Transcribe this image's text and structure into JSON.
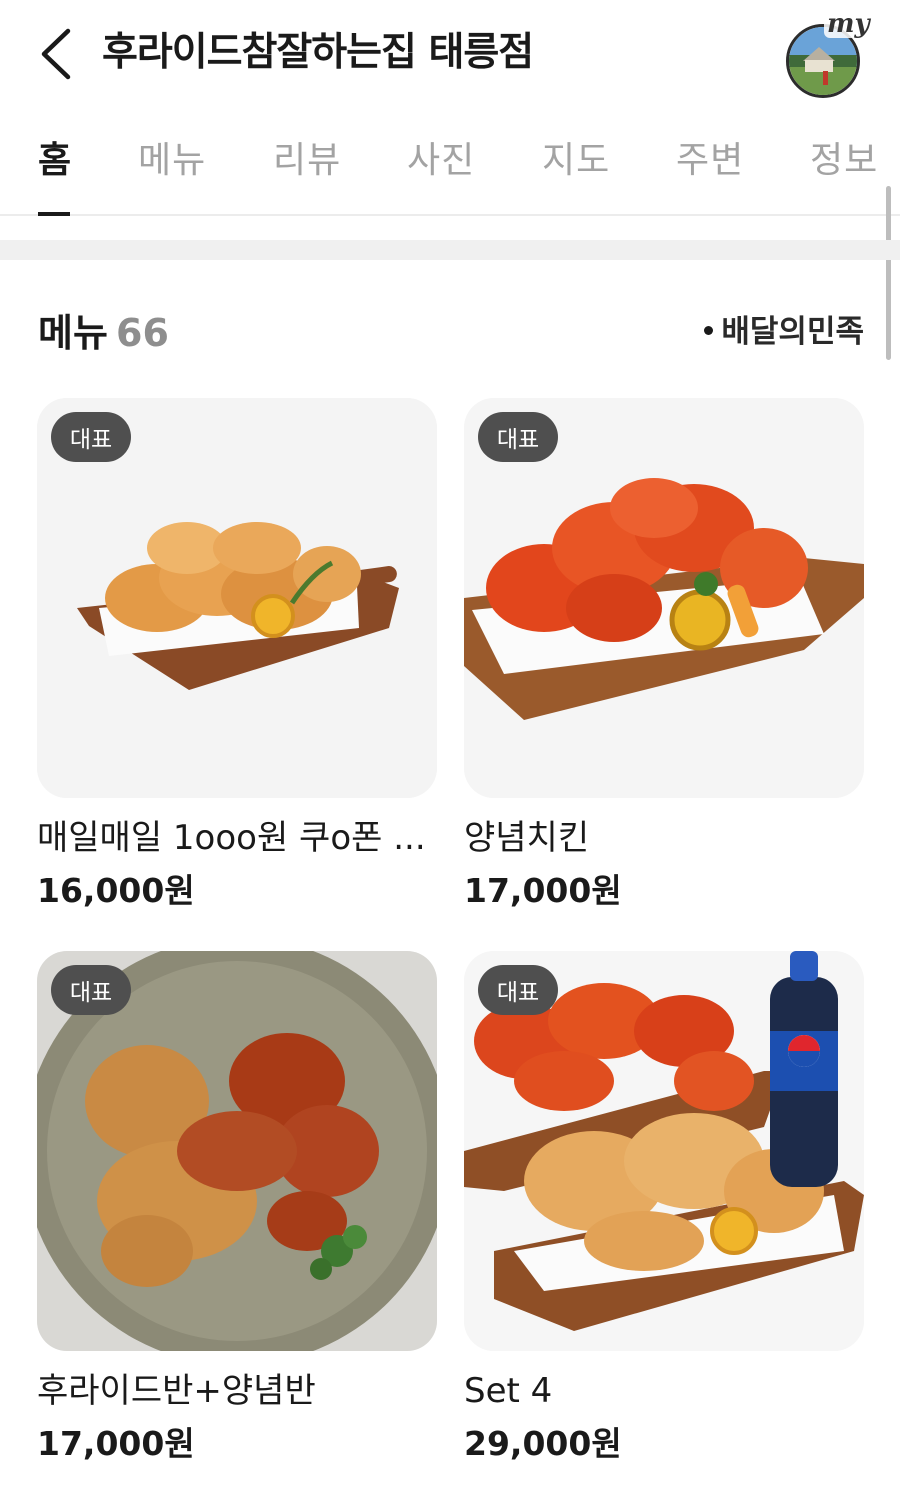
{
  "header": {
    "title": "후라이드참잘하는집 태릉점",
    "avatar_label": "my"
  },
  "tabs": [
    {
      "label": "홈",
      "active": true
    },
    {
      "label": "메뉴",
      "active": false
    },
    {
      "label": "리뷰",
      "active": false
    },
    {
      "label": "사진",
      "active": false
    },
    {
      "label": "지도",
      "active": false
    },
    {
      "label": "주변",
      "active": false
    },
    {
      "label": "정보",
      "active": false
    }
  ],
  "menu_section": {
    "title": "메뉴",
    "count": "66",
    "source": "배달의민족"
  },
  "menu_items": [
    {
      "badge": "대표",
      "name": "매일매일 1ooo원 쿠o폰 ...",
      "price": "16,000원",
      "image": "fried-chicken-on-board-image"
    },
    {
      "badge": "대표",
      "name": "양념치킨",
      "price": "17,000원",
      "image": "seasoned-chicken-on-board-image"
    },
    {
      "badge": "대표",
      "name": "후라이드반+양념반",
      "price": "17,000원",
      "image": "half-half-chicken-plate-image"
    },
    {
      "badge": "대표",
      "name": "Set 4",
      "price": "29,000원",
      "image": "chicken-set-with-cola-image"
    }
  ],
  "colors": {
    "badge_bg": "#4f4f4f",
    "inactive_tab": "#a3a3a3",
    "count_gray": "#8e8e8e",
    "divider_band": "#f0f0f0"
  }
}
